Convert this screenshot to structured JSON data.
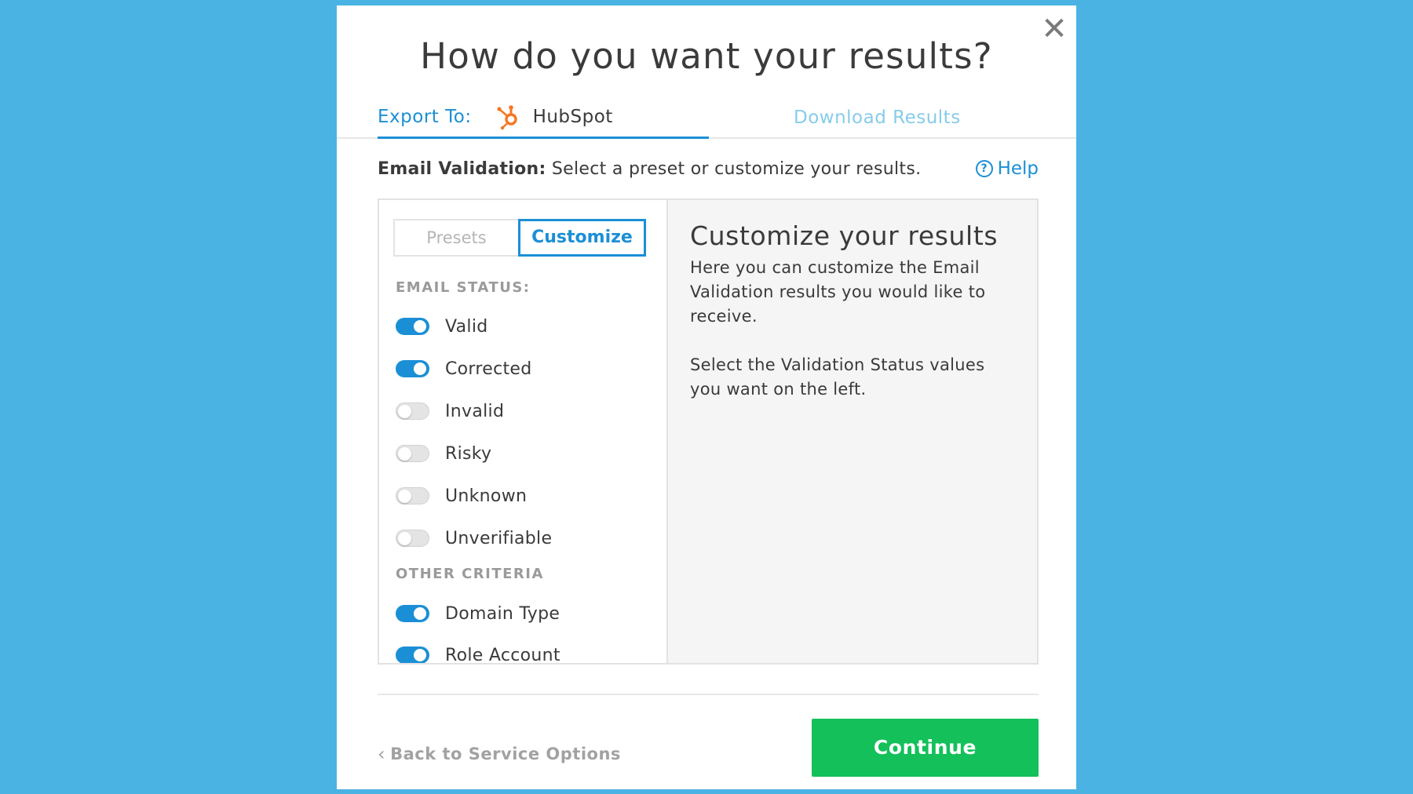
{
  "modal": {
    "title": "How do you want your results?",
    "close_glyph": "✕"
  },
  "tabs": {
    "export_label": "Export To:",
    "export_target": "HubSpot",
    "download_label": "Download Results"
  },
  "subhead": {
    "bold": "Email Validation:",
    "text": " Select a preset or customize your results."
  },
  "help": {
    "label": "Help",
    "icon_glyph": "?"
  },
  "segmented": {
    "presets_label": "Presets",
    "customize_label": "Customize",
    "selected": "Customize"
  },
  "email_status": {
    "label": "EMAIL STATUS:",
    "items": [
      {
        "label": "Valid",
        "on": true
      },
      {
        "label": "Corrected",
        "on": true
      },
      {
        "label": "Invalid",
        "on": false
      },
      {
        "label": "Risky",
        "on": false
      },
      {
        "label": "Unknown",
        "on": false
      },
      {
        "label": "Unverifiable",
        "on": false
      }
    ]
  },
  "other_criteria": {
    "label": "OTHER CRITERIA",
    "items": [
      {
        "label": "Domain Type",
        "on": true
      },
      {
        "label": "Role Account",
        "on": true
      }
    ]
  },
  "info": {
    "heading": "Customize your results",
    "paragraph1": "Here you can customize the Email Validation results you would like to receive.",
    "paragraph2": "Select the Validation Status values you want on the left."
  },
  "footer": {
    "back_label": "Back to Service Options",
    "back_glyph": "‹",
    "continue_label": "Continue"
  },
  "colors": {
    "background": "#4ab3e4",
    "accent": "#1b8fd6",
    "continue": "#13c05a",
    "hubspot": "#f57722"
  },
  "icons": [
    "close-icon",
    "hubspot-icon",
    "help-icon",
    "chevron-left-icon"
  ]
}
